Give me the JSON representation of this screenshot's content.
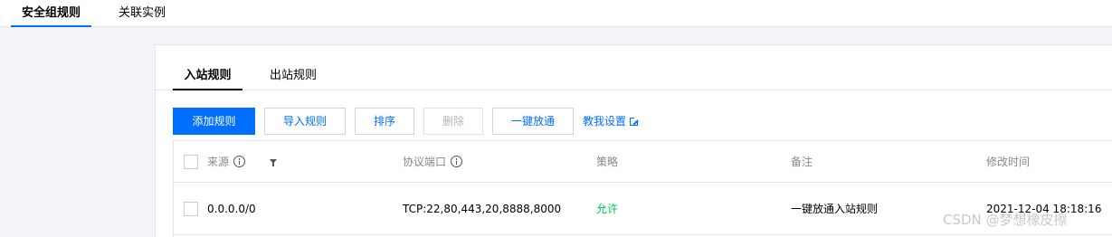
{
  "top_tabs": [
    "安全组规则",
    "关联实例"
  ],
  "sub_tabs": [
    "入站规则",
    "出站规则"
  ],
  "toolbar": {
    "add": "添加规则",
    "import": "导入规则",
    "sort": "排序",
    "delete": "删除",
    "one_click": "一键放通",
    "help": "教我设置"
  },
  "table": {
    "headers": {
      "source": "来源",
      "protocol_port": "协议端口",
      "policy": "策略",
      "remark": "备注",
      "modified": "修改时间"
    },
    "rows": [
      {
        "source": "0.0.0.0/0",
        "protocol_port": "TCP:22,80,443,20,8888,8000",
        "policy": "允许",
        "remark": "一键放通入站规则",
        "modified": "2021-12-04 18:18:16"
      }
    ]
  },
  "watermark": "CSDN @梦想橡皮擦",
  "colors": {
    "accent": "#006eff",
    "allow": "#0abf5b",
    "page_bg": "#f3f4f7"
  }
}
